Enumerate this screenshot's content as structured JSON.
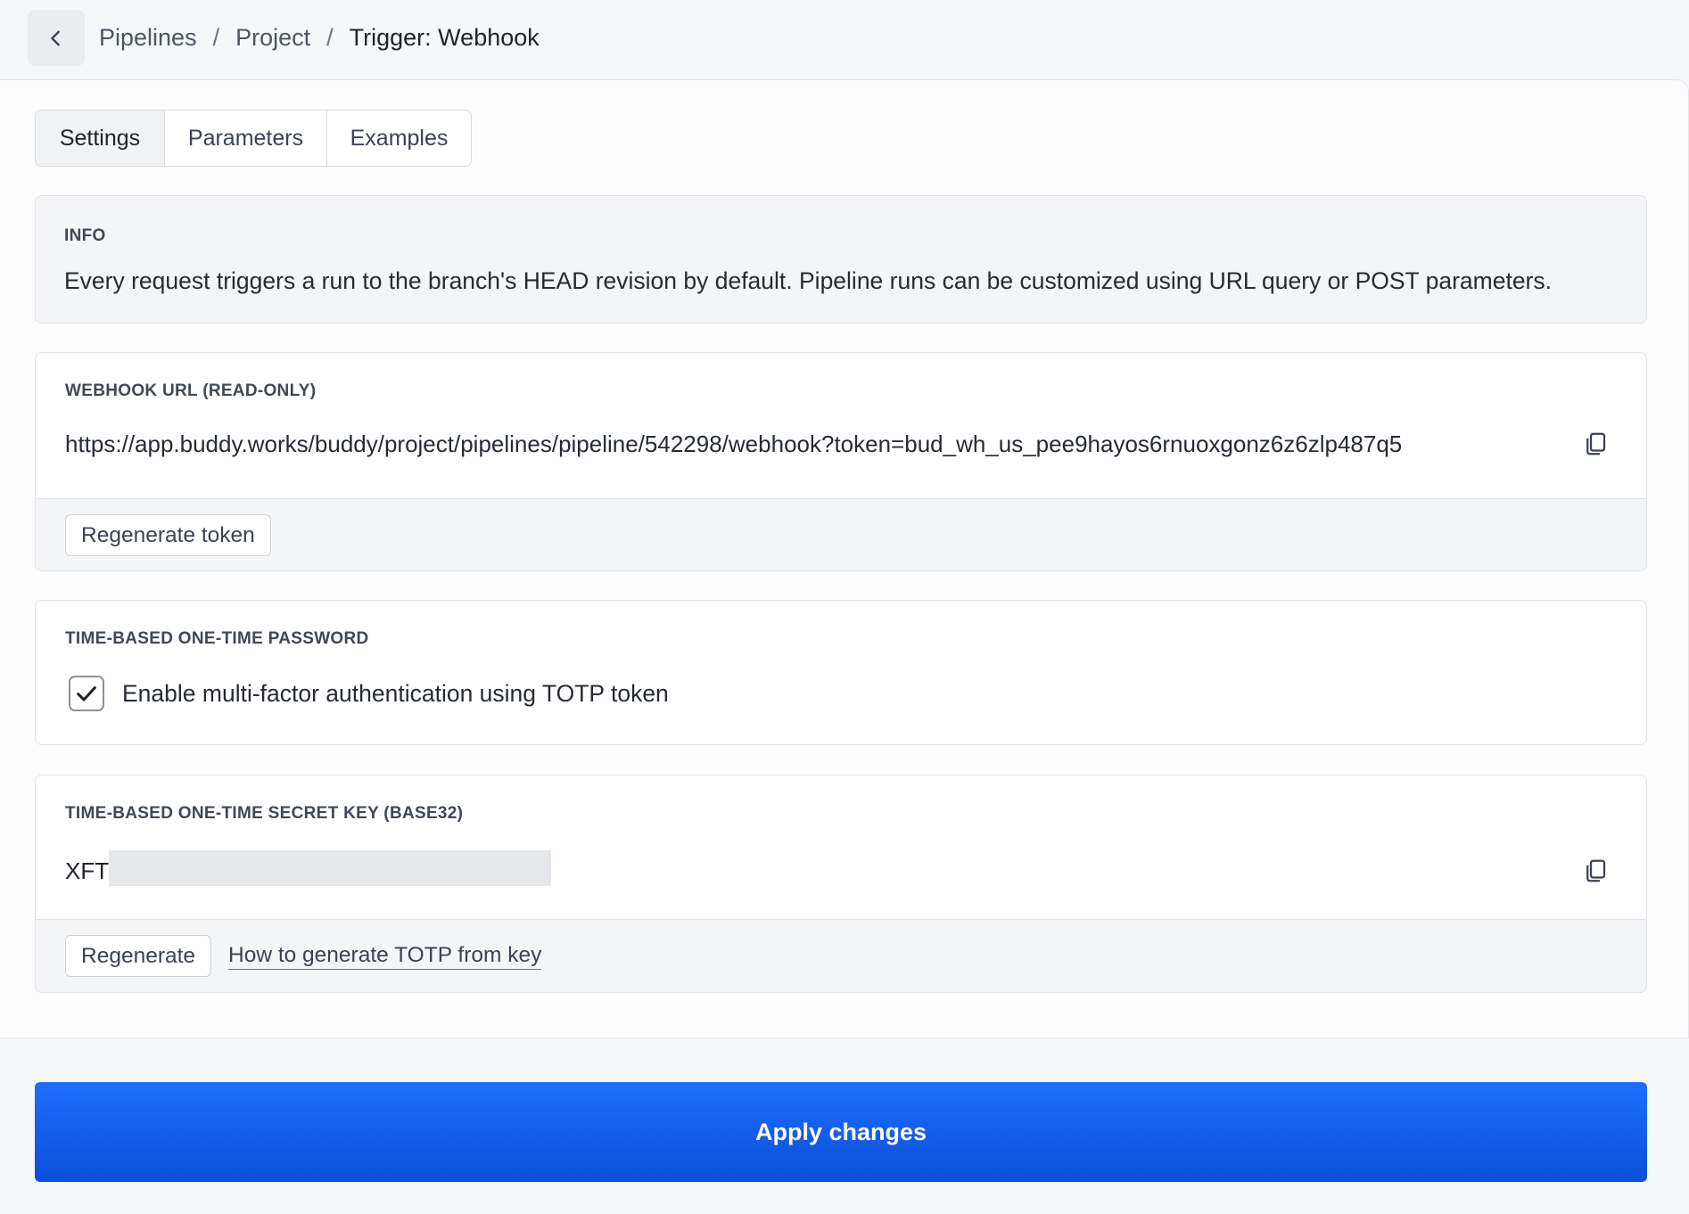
{
  "breadcrumb": {
    "items": [
      "Pipelines",
      "Project"
    ],
    "separator": "/",
    "current": "Trigger: Webhook"
  },
  "tabs": [
    {
      "label": "Settings",
      "active": true
    },
    {
      "label": "Parameters",
      "active": false
    },
    {
      "label": "Examples",
      "active": false
    }
  ],
  "info": {
    "label": "INFO",
    "text": "Every request triggers a run to the branch's HEAD revision by default. Pipeline runs can be customized using URL query or POST parameters."
  },
  "webhook": {
    "label": "WEBHOOK URL (READ-ONLY)",
    "url": "https://app.buddy.works/buddy/project/pipelines/pipeline/542298/webhook?token=bud_wh_us_pee9hayos6rnuoxgonz6z6zlp487q5",
    "copy_icon": "copy-icon",
    "regenerate_label": "Regenerate token"
  },
  "totp": {
    "label": "TIME-BASED ONE-TIME PASSWORD",
    "checkbox_label": "Enable multi-factor authentication using TOTP token",
    "checked": true
  },
  "secret": {
    "label": "TIME-BASED ONE-TIME SECRET KEY (BASE32)",
    "value_prefix": "XFT",
    "copy_icon": "copy-icon",
    "regenerate_label": "Regenerate",
    "help_link": "How to generate TOTP from key"
  },
  "apply_label": "Apply changes",
  "colors": {
    "primary": "#1a5cf0",
    "background": "#f6f7f9"
  }
}
